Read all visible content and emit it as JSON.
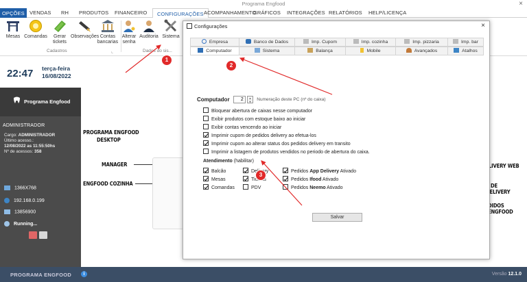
{
  "window": {
    "title": "Programa Engfood",
    "close_glyph": "×"
  },
  "menu": {
    "tabs": [
      "OPÇÕES",
      "VENDAS",
      "RH",
      "PRODUTOS",
      "FINANCEIRO",
      "CONFIGURAÇÕES",
      "ACOMPANHAMENTO",
      "GRÁFICOS",
      "INTEGRAÇÕES",
      "RELATÓRIOS",
      "HELP/LICENÇA"
    ],
    "active": "CONFIGURAÇÕES"
  },
  "ribbon": {
    "buttons": [
      {
        "label": "Mesas",
        "icon": "table-icon"
      },
      {
        "label": "Comandas",
        "icon": "comanda-icon"
      },
      {
        "label": "Gerar tickets",
        "icon": "ticket-icon"
      },
      {
        "label": "Observações",
        "icon": "note-icon"
      },
      {
        "label": "Contas bancarias",
        "icon": "bank-icon"
      },
      {
        "label": "Alterar senha",
        "icon": "user-key-icon"
      },
      {
        "label": "Auditoria",
        "icon": "audit-icon"
      },
      {
        "label": "Sistema",
        "icon": "tools-icon"
      }
    ],
    "group_cadastros": "Cadastros",
    "group_dados": "Dados do sis...",
    "launcher_glyph": "⌞"
  },
  "left": {
    "time": "22:47",
    "weekday": "terça-feira",
    "date": "16/08/2022",
    "brand": "Programa Engfood",
    "user": "ADMINISTRADOR",
    "cargo_label": "Cargo:",
    "cargo": "ADMINISTRADOR",
    "last_access_label": "Último acesso.:",
    "last_access": "12/08/2022 as 11:55:50hs",
    "access_count_label": "Nº de acessos:",
    "access_count": "358",
    "resolution": "1366X768",
    "ip": "192.168.0.199",
    "serial": "13856900",
    "status": "Running..."
  },
  "background": {
    "label_desktop_1": "PROGRAMA ENGFOOD",
    "label_desktop_2": "DESKTOP",
    "label_manager": "MANAGER",
    "label_cozinha": "ENGFOOD COZINHA",
    "right_1": "LIVERY WEB",
    "right_2": "P DE DELIVERY",
    "right_3": "DIDOS ENGFOOD"
  },
  "status": {
    "brand": "PROGRAMA ENGFOOD",
    "info_glyph": "i",
    "version_label": "Versão",
    "version": "12.1.0"
  },
  "dialog": {
    "title": "Configurações",
    "close": "×",
    "tabs_row1": [
      {
        "label": "Empresa",
        "icon": "search-icon"
      },
      {
        "label": "Banco de Dados",
        "icon": "database-icon"
      },
      {
        "label": "Imp. Cupom",
        "icon": "printer-icon"
      },
      {
        "label": "Imp. cozinha",
        "icon": "printer-icon"
      },
      {
        "label": "Imp. pizzaria",
        "icon": "printer-icon"
      },
      {
        "label": "Imp. bar",
        "icon": "printer-icon"
      }
    ],
    "tabs_row2": [
      {
        "label": "Computador",
        "icon": "monitor-icon"
      },
      {
        "label": "Sistema",
        "icon": "gear-icon"
      },
      {
        "label": "Balança",
        "icon": "scale-icon"
      },
      {
        "label": "Mobile",
        "icon": "mobile-icon"
      },
      {
        "label": "Avançados",
        "icon": "user-icon"
      },
      {
        "label": "Atalhos",
        "icon": "shortcut-icon"
      }
    ],
    "active_tab": "Computador",
    "computer_label": "Computador",
    "computer_value": "2",
    "computer_hint": "Numeração deste PC (nº do caixa)",
    "options": [
      {
        "label": "Bloquear abertura de caixas nesse computador",
        "checked": false
      },
      {
        "label": "Exibir produtos com estoque baixo ao iniciar",
        "checked": false
      },
      {
        "label": "Exibir contas vencendo ao iniciar",
        "checked": false
      },
      {
        "label": "Imprimir cupom de pedidos delivery ao efetua-los",
        "checked": true
      },
      {
        "label": "Imprimir cupom ao alterar status dos pedidos delivery em transito",
        "checked": true
      },
      {
        "label": "Imprimir a listagem de produtos vendidos no periodo de abertura do caixa.",
        "checked": false
      }
    ],
    "atendimento_title": "Atendimento",
    "atendimento_suffix": "(habilitar)",
    "col1": [
      {
        "label": "Balcão",
        "checked": true
      },
      {
        "label": "Mesas",
        "checked": true
      },
      {
        "label": "Comandas",
        "checked": true
      }
    ],
    "col2": [
      {
        "label": "Delivery",
        "checked": true
      },
      {
        "label": "Tickets",
        "checked": true
      },
      {
        "label": "PDV",
        "checked": false
      }
    ],
    "col3": [
      {
        "prefix": "Pedidos",
        "brand": "App Delivery",
        "status": "Ativado",
        "checked": true
      },
      {
        "prefix": "Pedidos",
        "brand": "Ifood",
        "status": "Ativado",
        "checked": true
      },
      {
        "prefix": "Pedidos",
        "brand": "Neemo",
        "status": "Ativado",
        "checked": false
      }
    ],
    "save": "Salvar"
  },
  "annotations": [
    "1",
    "2",
    "3"
  ],
  "colors": {
    "menu_blue": "#1f5ea8",
    "dark_panel": "#4b4b4b",
    "status_bar": "#3b4e66",
    "annotation_red": "#e12a2a"
  }
}
